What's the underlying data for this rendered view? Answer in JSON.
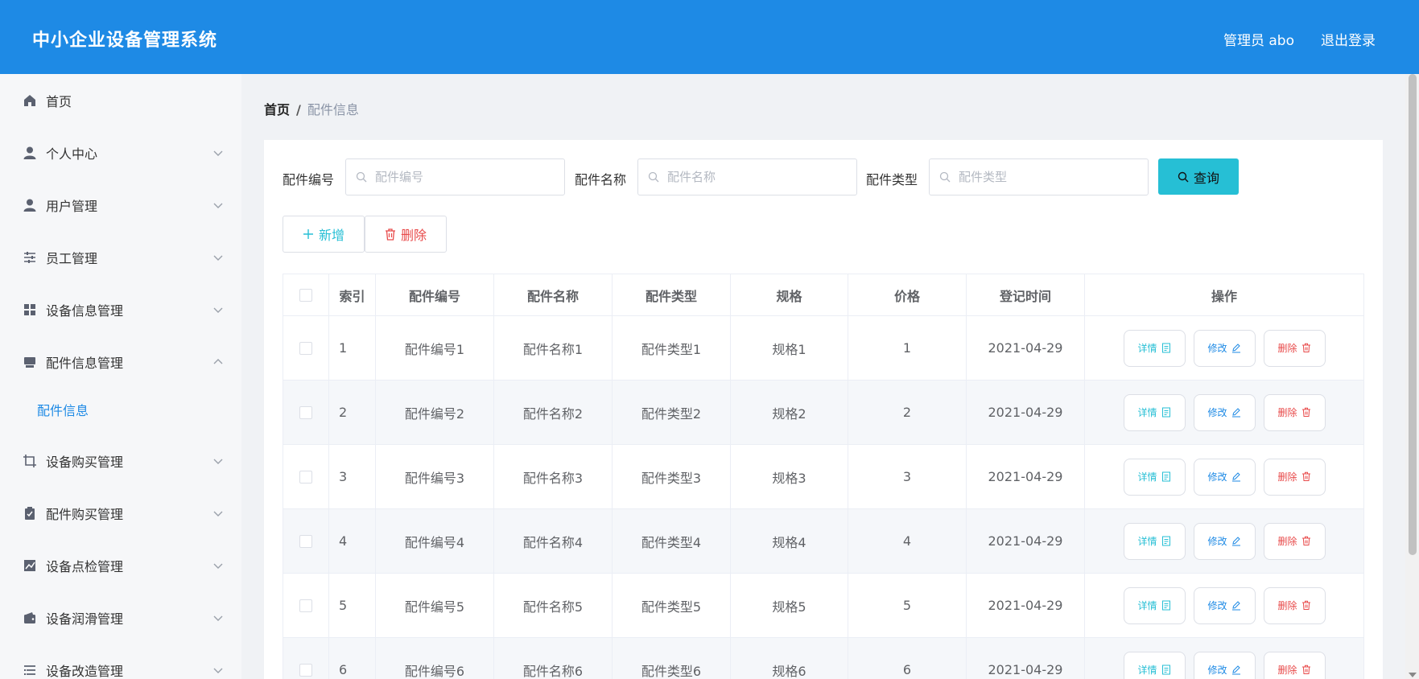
{
  "header": {
    "title": "中小企业设备管理系统",
    "user": "管理员 abo",
    "logout": "退出登录"
  },
  "sidebar": {
    "items": [
      {
        "label": "首页",
        "icon": "home-icon",
        "chevron": "none"
      },
      {
        "label": "个人中心",
        "icon": "user-icon",
        "chevron": "down"
      },
      {
        "label": "用户管理",
        "icon": "user-icon",
        "chevron": "down"
      },
      {
        "label": "员工管理",
        "icon": "sliders-icon",
        "chevron": "down"
      },
      {
        "label": "设备信息管理",
        "icon": "grid-icon",
        "chevron": "down"
      },
      {
        "label": "配件信息管理",
        "icon": "tray-icon",
        "chevron": "up"
      },
      {
        "label": "设备购买管理",
        "icon": "crop-icon",
        "chevron": "down"
      },
      {
        "label": "配件购买管理",
        "icon": "clipboard-check-icon",
        "chevron": "down"
      },
      {
        "label": "设备点检管理",
        "icon": "chart-icon",
        "chevron": "down"
      },
      {
        "label": "设备润滑管理",
        "icon": "wallet-icon",
        "chevron": "down"
      },
      {
        "label": "设备改造管理",
        "icon": "list-icon",
        "chevron": "down"
      }
    ],
    "submenu": {
      "label": "配件信息"
    }
  },
  "breadcrumb": {
    "home": "首页",
    "separator": "/",
    "current": "配件信息"
  },
  "search": {
    "fields": [
      {
        "label": "配件编号",
        "placeholder": "配件编号"
      },
      {
        "label": "配件名称",
        "placeholder": "配件名称"
      },
      {
        "label": "配件类型",
        "placeholder": "配件类型"
      }
    ],
    "query_label": "查询"
  },
  "actions": {
    "add_label": "新增",
    "delete_label": "删除"
  },
  "table": {
    "columns": [
      "索引",
      "配件编号",
      "配件名称",
      "配件类型",
      "规格",
      "价格",
      "登记时间",
      "操作"
    ],
    "rows": [
      [
        "1",
        "配件编号1",
        "配件名称1",
        "配件类型1",
        "规格1",
        "1",
        "2021-04-29"
      ],
      [
        "2",
        "配件编号2",
        "配件名称2",
        "配件类型2",
        "规格2",
        "2",
        "2021-04-29"
      ],
      [
        "3",
        "配件编号3",
        "配件名称3",
        "配件类型3",
        "规格3",
        "3",
        "2021-04-29"
      ],
      [
        "4",
        "配件编号4",
        "配件名称4",
        "配件类型4",
        "规格4",
        "4",
        "2021-04-29"
      ],
      [
        "5",
        "配件编号5",
        "配件名称5",
        "配件类型5",
        "规格5",
        "5",
        "2021-04-29"
      ],
      [
        "6",
        "配件编号6",
        "配件名称6",
        "配件类型6",
        "规格6",
        "6",
        "2021-04-29"
      ]
    ],
    "ops": {
      "detail": "详情",
      "edit": "修改",
      "delete": "删除"
    }
  },
  "colors": {
    "header_bg": "#1e8ae5",
    "accent_cyan": "#26bfd5",
    "accent_blue": "#1e8ae5",
    "danger": "#e84a4a"
  }
}
